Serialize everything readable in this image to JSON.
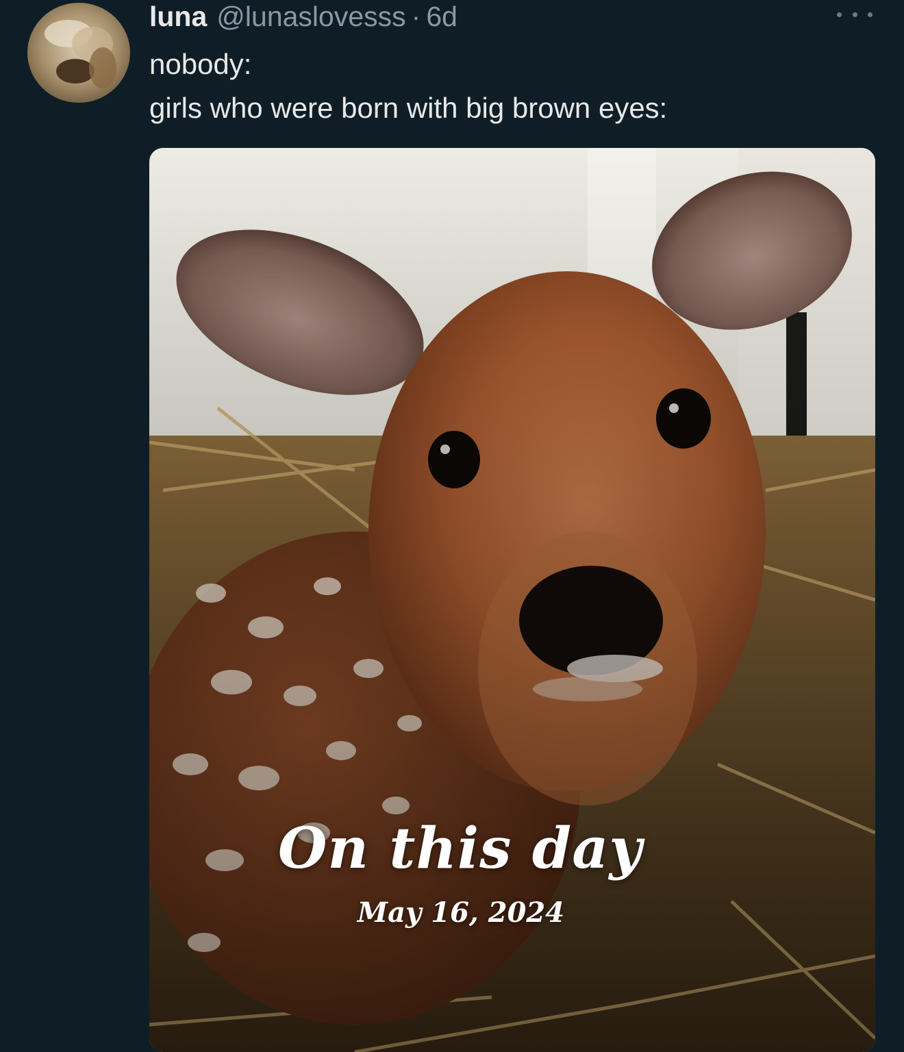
{
  "tweet": {
    "display_name": "luna",
    "handle": "@lunaslovesss",
    "separator": "·",
    "time": "6d",
    "more_icon": "more-horizontal-icon",
    "text_lines": [
      "nobody:",
      "girls who were born with big brown eyes:"
    ],
    "avatar_icon": "profile-avatar"
  },
  "media": {
    "overlay_title": "On this day",
    "overlay_date": "May 16, 2024"
  }
}
